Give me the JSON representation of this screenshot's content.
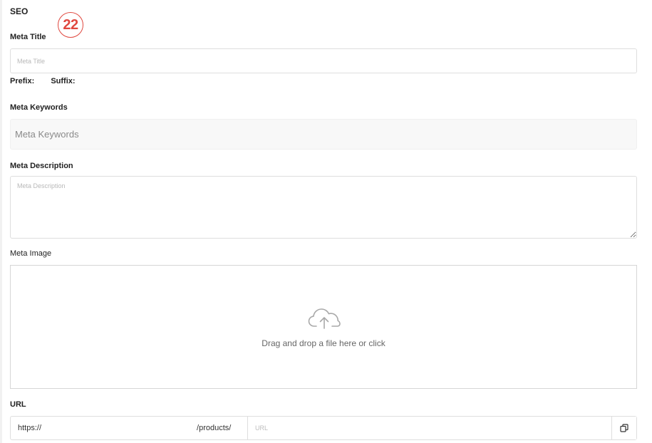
{
  "seo": {
    "section_title": "SEO",
    "step_number": "22",
    "meta_title": {
      "label": "Meta Title",
      "placeholder": "Meta Title",
      "value": ""
    },
    "prefix_label": "Prefix:",
    "suffix_label": "Suffix:",
    "meta_keywords": {
      "label": "Meta Keywords",
      "placeholder": "Meta Keywords",
      "value": ""
    },
    "meta_description": {
      "label": "Meta Description",
      "placeholder": "Meta Description",
      "value": ""
    },
    "meta_image": {
      "label": "Meta Image",
      "dropzone_text": "Drag and drop a file here or click",
      "icon": "cloud-upload-icon"
    },
    "url": {
      "label": "URL",
      "scheme": "https://",
      "path": "/products/",
      "placeholder": "URL",
      "value": "",
      "copy_icon": "copy-icon"
    }
  },
  "colors": {
    "accent": "#e0483f",
    "border": "#dedede",
    "muted_text": "#666666"
  }
}
